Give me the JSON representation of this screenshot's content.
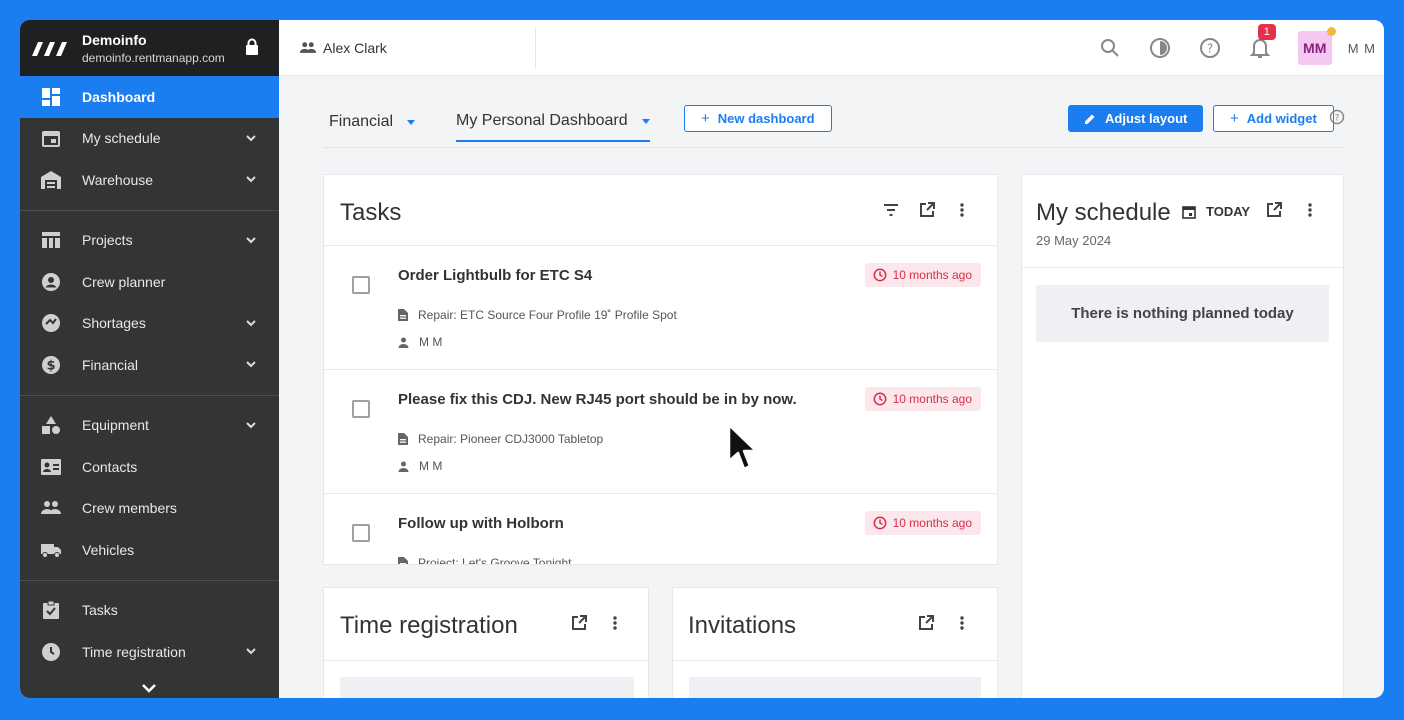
{
  "brand": {
    "name": "Demoinfo",
    "domain": "demoinfo.rentmanapp.com",
    "logo_icon": "brand-logo-icon",
    "lock_icon": "lock-icon"
  },
  "sidebar": {
    "items": [
      {
        "label": "Dashboard",
        "icon": "dashboard-icon",
        "active": true,
        "expandable": false
      },
      {
        "label": "My schedule",
        "icon": "calendar-icon",
        "expandable": true
      },
      {
        "label": "Warehouse",
        "icon": "warehouse-icon",
        "expandable": true
      },
      {
        "label": "Projects",
        "icon": "projects-icon",
        "expandable": true
      },
      {
        "label": "Crew planner",
        "icon": "crew-planner-icon",
        "expandable": false
      },
      {
        "label": "Shortages",
        "icon": "shortages-icon",
        "expandable": true
      },
      {
        "label": "Financial",
        "icon": "dollar-icon",
        "expandable": true
      },
      {
        "label": "Equipment",
        "icon": "equipment-icon",
        "expandable": true
      },
      {
        "label": "Contacts",
        "icon": "contacts-icon",
        "expandable": false
      },
      {
        "label": "Crew members",
        "icon": "crew-members-icon",
        "expandable": false
      },
      {
        "label": "Vehicles",
        "icon": "vehicle-icon",
        "expandable": false
      },
      {
        "label": "Tasks",
        "icon": "tasks-icon",
        "expandable": false
      },
      {
        "label": "Time registration",
        "icon": "clock-icon",
        "expandable": true
      }
    ]
  },
  "topbar": {
    "user_selector": "Alex Clark",
    "notification_count": "1",
    "avatar_initials": "MM",
    "user_initials": "M M"
  },
  "dashboard": {
    "tabs": [
      {
        "label": "Financial",
        "active": false
      },
      {
        "label": "My Personal Dashboard",
        "active": true
      }
    ],
    "new_dashboard": "New dashboard",
    "adjust_layout": "Adjust layout",
    "add_widget": "Add widget"
  },
  "tasks_widget": {
    "title": "Tasks",
    "items": [
      {
        "title": "Order Lightbulb for ETC S4",
        "time": "10 months ago",
        "ref": "Repair: ETC Source Four Profile 19˚ Profile Spot",
        "assignee": "M M"
      },
      {
        "title": "Please fix this CDJ. New RJ45 port should be in by now.",
        "time": "10 months ago",
        "ref": "Repair: Pioneer CDJ3000 Tabletop",
        "assignee": "M M"
      },
      {
        "title": "Follow up with Holborn",
        "time": "10 months ago",
        "ref": "Project: Let's Groove Tonight",
        "assignee": ""
      }
    ]
  },
  "schedule_widget": {
    "title": "My schedule",
    "today": "TODAY",
    "date": "29 May 2024",
    "empty": "There is nothing planned today"
  },
  "time_registration_widget": {
    "title": "Time registration"
  },
  "invitations_widget": {
    "title": "Invitations"
  },
  "colors": {
    "accent": "#1a7df0",
    "sidebar": "#333436",
    "danger": "#d62f4b",
    "avatar_bg": "#f4c8f0"
  }
}
